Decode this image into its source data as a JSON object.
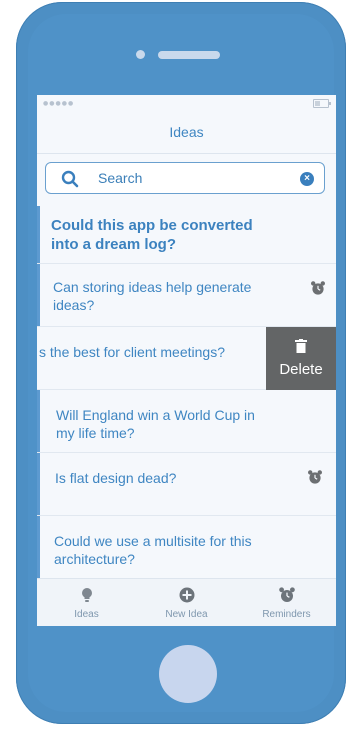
{
  "navbar": {
    "title": "Ideas"
  },
  "search": {
    "placeholder": "Search",
    "clear_icon": "×"
  },
  "status": {
    "signal_dots": "●●●●●",
    "battery_level": 0.4
  },
  "list": [
    {
      "text_lines": [
        "Could this app be converted",
        "into a dream log?"
      ],
      "featured": true,
      "reminder": false
    },
    {
      "text_lines": [
        "Can storing ideas help generate",
        "ideas?"
      ],
      "featured": false,
      "reminder": true
    },
    {
      "text_lines": [
        "s the best for client meetings?"
      ],
      "featured": false,
      "reminder": false,
      "swiped": true
    },
    {
      "text_lines": [
        "Will England win a World Cup in",
        "my life time?"
      ],
      "featured": false,
      "reminder": false
    },
    {
      "text_lines": [
        "Is flat design dead?"
      ],
      "featured": false,
      "reminder": true
    },
    {
      "text_lines": [
        "Could we use a multisite for this",
        "architecture?"
      ],
      "featured": false,
      "reminder": false
    }
  ],
  "swipe_action": {
    "label": "Delete",
    "icon": "trash-icon"
  },
  "tabbar": [
    {
      "label": "Ideas",
      "icon": "lightbulb-icon"
    },
    {
      "label": "New Idea",
      "icon": "plus-circle-icon"
    },
    {
      "label": "Reminders",
      "icon": "alarm-clock-icon"
    }
  ],
  "colors": {
    "phone": "#4d8fc4",
    "accent": "#3f86c2",
    "screen_bg": "#f5f8fc",
    "delete_bg": "#636566",
    "home_button": "#c8d6ee"
  }
}
